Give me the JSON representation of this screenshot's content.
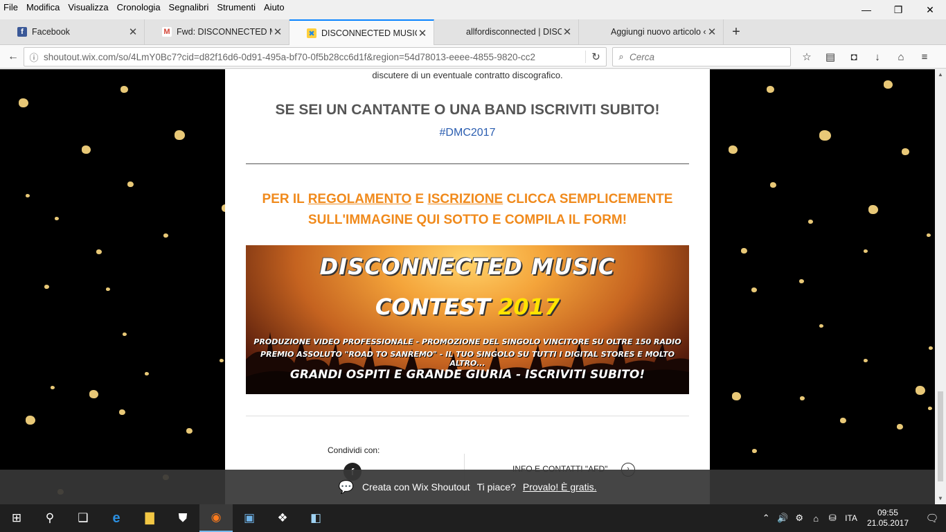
{
  "menu": [
    "File",
    "Modifica",
    "Visualizza",
    "Cronologia",
    "Segnalibri",
    "Strumenti",
    "Aiuto"
  ],
  "window_controls": {
    "minimize": "—",
    "restore": "❐",
    "close": "✕"
  },
  "tabs": [
    {
      "title": "Facebook",
      "favicon": "f",
      "favicon_color": "#3b5998",
      "close": "✕"
    },
    {
      "title": "Fwd: DISCONNECTED MUSIC",
      "favicon": "M",
      "favicon_color": "#d44638",
      "close": "✕"
    },
    {
      "title": "DISCONNECTED MUSIC CON",
      "favicon": "✖",
      "favicon_color": "#1e88e5",
      "close": "✕"
    },
    {
      "title": "allfordisconnected | DISCON",
      "favicon": "",
      "favicon_color": "#e3e3e3",
      "close": "✕"
    },
    {
      "title": "Aggiungi nuovo articolo ‹ ETiCin",
      "favicon": "",
      "favicon_color": "#e3e3e3",
      "close": "✕"
    }
  ],
  "new_tab": "+",
  "nav": {
    "back": "←",
    "info": "ⓘ",
    "url": "shoutout.wix.com/so/4LmY0Bc7?cid=d82f16d6-0d91-495a-bf70-0f5b28cc6d1f&region=54d78013-eeee-4855-9820-cc2",
    "reload": "↻",
    "search_icon": "⌕",
    "search_placeholder": "Cerca",
    "toolbar": [
      "☆",
      "▤",
      "◘",
      "↓",
      "⌂",
      "≡"
    ]
  },
  "page": {
    "top_line": "discutere di un eventuale contratto discografico.",
    "heading": "SE SEI UN CANTANTE O UNA BAND ISCRIVITI SUBITO!",
    "hashtag": "#DMC2017",
    "cta_1": "PER IL ",
    "cta_link1": "REGOLAMENTO",
    "cta_2": " E ",
    "cta_link2": "ISCRIZIONE",
    "cta_3": " CLICCA SEMPLICEMENTE",
    "cta_line2": "SULL'IMMAGINE QUI SOTTO E COMPILA IL FORM!",
    "banner": {
      "line1": "DISCONNECTED MUSIC",
      "line2": "CONTEST",
      "year": "2017",
      "line3": "PRODUZIONE VIDEO PROFESSIONALE - PROMOZIONE DEL SINGOLO VINCITORE SU OLTRE 150 RADIO",
      "line4": "PREMIO ASSOLUTO \"ROAD TO SANREMO\" - IL TUO SINGOLO SU TUTTI I DIGITAL STORES E MOLTO ALTRO...",
      "line5": "GRANDI OSPITI E GRANDE GIURIA - ISCRIVITI SUBITO!"
    },
    "share_label": "Condividi con:",
    "share_fb": "f",
    "info_link": "INFO E CONTATTI \"AFD\"",
    "info_arrow": "›"
  },
  "wix_bar": {
    "bubble": "💬",
    "text": "Creata con Wix Shoutout",
    "prompt": "Ti piace?",
    "link": "Provalo! È gratis."
  },
  "taskbar": {
    "items": [
      "⊞",
      "⚲",
      "❑",
      "e",
      "▇",
      "⛊",
      "◉",
      "▣",
      "❖",
      "◧"
    ],
    "tray": [
      "⌃",
      "🔊",
      "⚙",
      "⌂",
      "⛁"
    ],
    "lang": "ITA",
    "time": "09:55",
    "date": "21.05.2017",
    "notif": "🗨"
  },
  "colors": {
    "accent_tab": "#0a84ff",
    "orange_text": "#f08a1c",
    "hashtag": "#2a5db0",
    "confetti": "#e8c877"
  }
}
